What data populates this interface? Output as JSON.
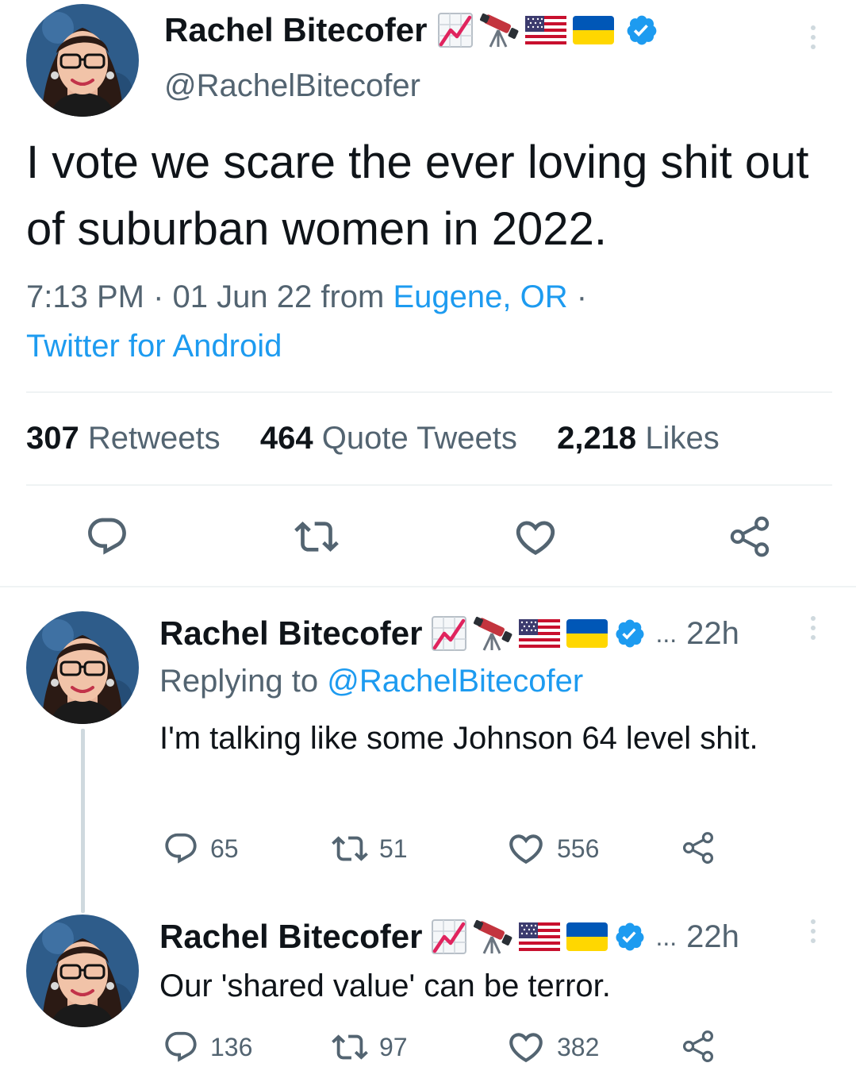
{
  "main_tweet": {
    "author": {
      "name": "Rachel Bitecofer",
      "handle": "@RachelBitecofer",
      "badge_icons": [
        "chart-increasing-icon",
        "telescope-icon",
        "us-flag-icon",
        "ukraine-flag-icon",
        "verified-badge-icon"
      ]
    },
    "text": "I vote we scare the ever loving shit out of suburban women in 2022.",
    "time": "7:13 PM",
    "sep1": "·",
    "date": "01 Jun 22",
    "from_word": "from",
    "location": "Eugene, OR",
    "sep2": "·",
    "source": "Twitter for Android",
    "stats": {
      "retweets_count": "307",
      "retweets_label": "Retweets",
      "quotes_count": "464",
      "quotes_label": "Quote Tweets",
      "likes_count": "2,218",
      "likes_label": "Likes"
    }
  },
  "replies": [
    {
      "name": "Rachel Bitecofer",
      "ellipsis": "...",
      "time": "22h",
      "replying_prefix": "Replying to",
      "replying_handle": "@RachelBitecofer",
      "text": "I'm talking like some Johnson 64 level shit.",
      "reply_count": "65",
      "retweet_count": "51",
      "like_count": "556"
    },
    {
      "name": "Rachel Bitecofer",
      "ellipsis": "...",
      "time": "22h",
      "text": "Our 'shared value' can be terror.",
      "reply_count": "136",
      "retweet_count": "97",
      "like_count": "382"
    }
  ],
  "colors": {
    "accent": "#1d9bf0",
    "text": "#0f1419",
    "muted": "#536471",
    "divider": "#eff3f4"
  }
}
